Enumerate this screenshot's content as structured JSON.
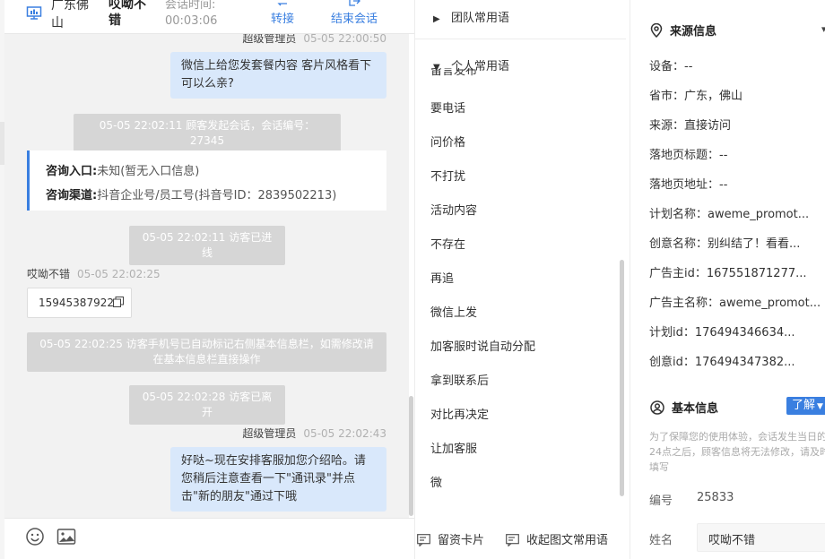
{
  "header": {
    "location": "广东佛山",
    "visitor_name": "哎呦不错",
    "time_label": "会话时间:",
    "time_value": "00:03:06",
    "transfer_label": "转接",
    "end_label": "结束会话"
  },
  "chat": {
    "messages": [
      {
        "sender": "超级管理员",
        "time": "05-05 22:00:50",
        "text": "微信上给您发套餐内容 客片风格看下可以么亲?"
      },
      {
        "system": "05-05 22:02:11 顾客发起会话，会话编号：27345"
      },
      {
        "entry_label": "咨询入口:",
        "entry_value": "未知(暂无入口信息)",
        "channel_label": "咨询渠道:",
        "channel_value": "抖音企业号/员工号(抖音号ID：2839502213)"
      },
      {
        "system": "05-05 22:02:11 访客已进线"
      },
      {
        "sender": "哎呦不错",
        "time": "05-05 22:02:25",
        "text": "15945387922"
      },
      {
        "system": "05-05 22:02:25 访客手机号已自动标记右侧基本信息栏，如需修改请在基本信息栏直接操作"
      },
      {
        "system": "05-05 22:02:28 访客已离开"
      },
      {
        "sender": "超级管理员",
        "time": "05-05 22:02:43",
        "text": "好哒~现在安排客服加您介绍哈。请您稍后注意查看一下\"通讯录\"并点击\"新的朋友\"通过下哦"
      }
    ]
  },
  "footer_icons": [
    "emoji-icon",
    "image-icon"
  ],
  "phrases": {
    "team_group": "团队常用语",
    "personal_group": "个人常用语",
    "clipped_item": "留言发布",
    "items": [
      "要电话",
      "问价格",
      "不打扰",
      "活动内容",
      "不存在",
      "再追",
      "微信上发",
      "加客服时说自动分配",
      "拿到联系后",
      "对比再决定",
      "让加客服",
      "微"
    ],
    "footer_card": "留资卡片",
    "footer_collapse": "收起图文常用语"
  },
  "source": {
    "title": "来源信息",
    "rows": [
      "设备：--",
      "省市：广东，佛山",
      "来源：直接访问",
      "落地页标题：--",
      "落地页地址：--",
      "计划名称：aweme_promot...",
      "创意名称：别纠结了！看看...",
      "广告主id：167551871277...",
      "广告主名称：aweme_promot...",
      "计划id：176494346634...",
      "创意id：176494347382..."
    ]
  },
  "basic": {
    "title": "基本信息",
    "learn_label": "了解",
    "notice": "为了保障您的使用体验，会话发生当日的24点之后，顾客信息将无法修改，请及时填写",
    "id_label": "编号",
    "id_value": "25833",
    "name_label": "姓名",
    "name_value": "哎呦不错"
  },
  "colors": {
    "accent": "#3a7fe0",
    "my_bubble": "#d9e8fb",
    "system_pill": "#d6d6d6"
  }
}
